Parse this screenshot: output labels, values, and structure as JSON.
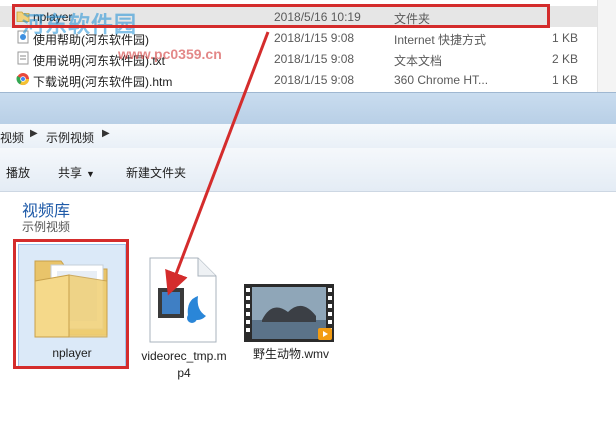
{
  "file_list": {
    "rows": [
      {
        "name": "nplayer",
        "date": "2018/5/16 10:19",
        "type": "文件夹",
        "size": "",
        "icon": "folder-icon",
        "selected": true
      },
      {
        "name": "使用帮助(河东软件园)",
        "date": "2018/1/15 9:08",
        "type": "Internet 快捷方式",
        "size": "1 KB",
        "icon": "internet-shortcut-icon",
        "selected": false
      },
      {
        "name": "使用说明(河东软件园).txt",
        "date": "2018/1/15 9:08",
        "type": "文本文档",
        "size": "2 KB",
        "icon": "text-document-icon",
        "selected": false
      },
      {
        "name": "下载说明(河东软件园).htm",
        "date": "2018/1/15 9:08",
        "type": "360 Chrome HT...",
        "size": "1 KB",
        "icon": "chrome-html-icon",
        "selected": false
      }
    ],
    "watermark": "河东软件园",
    "watermark_url": "www.pc0359.cn"
  },
  "breadcrumb": {
    "items": [
      "视频",
      "示例视频"
    ]
  },
  "toolbar": {
    "play_label": "播放",
    "share_label": "共享",
    "new_folder_label": "新建文件夹"
  },
  "library": {
    "title": "视频库",
    "subtitle": "示例视频"
  },
  "tiles": [
    {
      "label": "nplayer",
      "icon": "folder-icon"
    },
    {
      "label_line1": "videorec_tmp.m",
      "label_line2": "p4",
      "icon": "media-file-icon"
    },
    {
      "label": "野生动物.wmv",
      "icon": "video-thumbnail-icon"
    }
  ],
  "colors": {
    "annotation_red": "#d42c2c",
    "library_title": "#1e5aa8",
    "selection": "#dbe9f8"
  }
}
